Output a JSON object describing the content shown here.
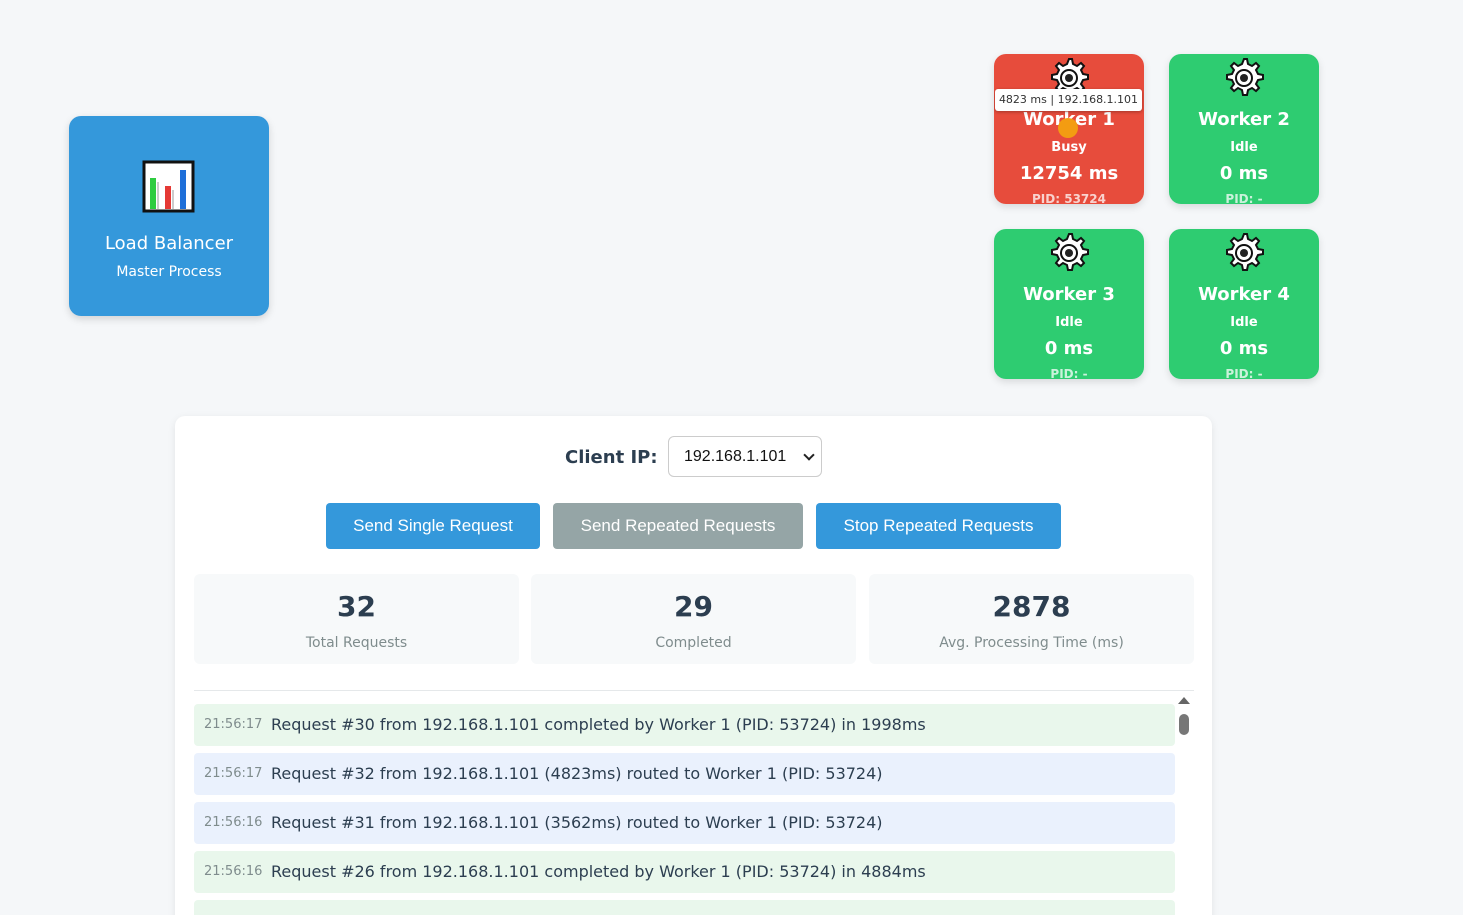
{
  "load_balancer": {
    "icon": "bar-chart-icon",
    "title": "Load Balancer",
    "subtitle": "Master Process"
  },
  "workers": [
    {
      "name": "Worker 1",
      "status": "Busy",
      "time": "12754 ms",
      "pid": "PID: 53724",
      "color": "#e74c3c",
      "tooltip": "4823 ms | 192.168.1.101"
    },
    {
      "name": "Worker 2",
      "status": "Idle",
      "time": "0 ms",
      "pid": "PID: -",
      "color": "#2ecc71"
    },
    {
      "name": "Worker 3",
      "status": "Idle",
      "time": "0 ms",
      "pid": "PID: -",
      "color": "#2ecc71"
    },
    {
      "name": "Worker 4",
      "status": "Idle",
      "time": "0 ms",
      "pid": "PID: -",
      "color": "#2ecc71"
    }
  ],
  "controls": {
    "client_ip_label": "Client IP:",
    "client_ip_value": "192.168.1.101",
    "send_single": "Send Single Request",
    "send_repeated": "Send Repeated Requests",
    "stop_repeated": "Stop Repeated Requests"
  },
  "stats": [
    {
      "value": "32",
      "label": "Total Requests"
    },
    {
      "value": "29",
      "label": "Completed"
    },
    {
      "value": "2878",
      "label": "Avg. Processing Time (ms)"
    }
  ],
  "log": [
    {
      "time": "21:56:17",
      "message": "Request #30 from 192.168.1.101 completed by Worker 1 (PID: 53724) in 1998ms",
      "type": "done"
    },
    {
      "time": "21:56:17",
      "message": "Request #32 from 192.168.1.101 (4823ms) routed to Worker 1 (PID: 53724)",
      "type": "route"
    },
    {
      "time": "21:56:16",
      "message": "Request #31 from 192.168.1.101 (3562ms) routed to Worker 1 (PID: 53724)",
      "type": "route"
    },
    {
      "time": "21:56:16",
      "message": "Request #26 from 192.168.1.101 completed by Worker 1 (PID: 53724) in 4884ms",
      "type": "done"
    }
  ],
  "colors": {
    "accent": "#3498db",
    "busy": "#e74c3c",
    "idle": "#2ecc71",
    "disabled": "#95a5a6",
    "request_dot": "#f39c12"
  }
}
